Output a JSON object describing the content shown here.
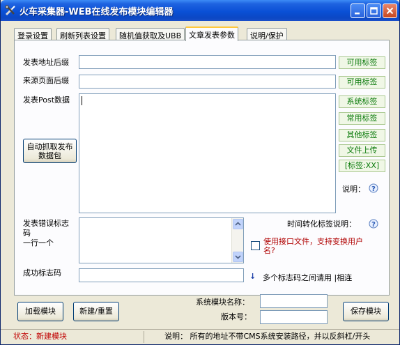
{
  "window": {
    "title": "火车采集器-WEB在线发布模块编辑器"
  },
  "tabs": [
    {
      "label": "登录设置"
    },
    {
      "label": "刷新列表设置"
    },
    {
      "label": "随机值获取及UBB"
    },
    {
      "label": "文章发表参数"
    },
    {
      "label": "说明/保护"
    }
  ],
  "form": {
    "post_url_suffix_label": "发表地址后缀",
    "post_url_suffix_value": "",
    "source_page_suffix_label": "来源页面后缀",
    "source_page_suffix_value": "",
    "post_data_label": "发表Post数据",
    "post_data_value": "",
    "auto_capture_button": "自动抓取发布数据包",
    "error_code_label": "发表错误标志码\n一行一个",
    "error_code_value": "",
    "success_code_label": "成功标志码",
    "success_code_value": ""
  },
  "side_buttons": {
    "available_tags_1": "可用标签",
    "available_tags_2": "可用标签",
    "system_tags": "系统标签",
    "common_tags": "常用标签",
    "other_tags": "其他标签",
    "file_upload": "文件上传",
    "tag_xx": "[标签:XX]",
    "description_label": "说明："
  },
  "right_area": {
    "time_conv_help": "时间转化标签说明：",
    "use_interface_checkbox": "使用接口文件，支持变换用户名?",
    "use_interface_checked": false,
    "separator_note_arrow": "↓",
    "separator_note": "多个标志码之间请用 |相连"
  },
  "bottom": {
    "load_module_button": "加载模块",
    "new_reset_button": "新建/重置",
    "system_module_name_label": "系统模块名称：",
    "system_module_name_value": "",
    "version_label": "版本号：",
    "version_value": "",
    "save_module_button": "保存模块"
  },
  "status": {
    "state_text": "状态：新建模块",
    "description_text": "说明：  所有的地址不带CMS系统安装路径，并以反斜杠/开头"
  },
  "colors": {
    "title_gradient": "#0a50d6",
    "status_red": "#c00000",
    "tag_green": "#0a7a0a",
    "checkbox_text_red": "#b00000"
  }
}
